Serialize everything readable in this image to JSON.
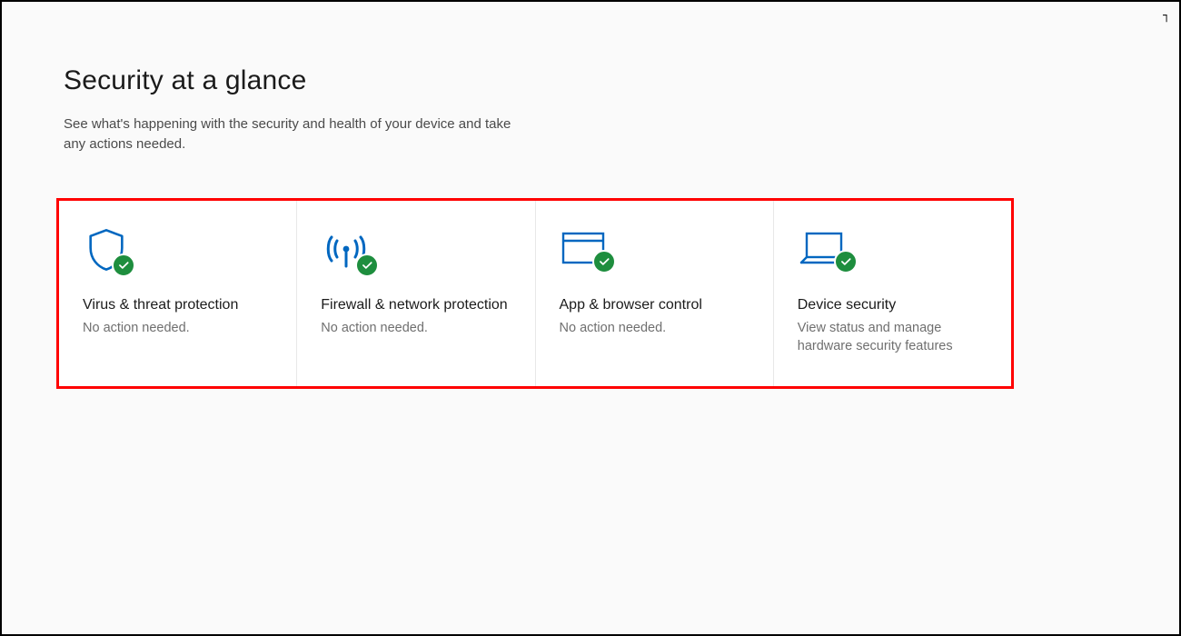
{
  "header": {
    "title": "Security at a glance",
    "subtitle": "See what's happening with the security and health of your device and take any actions needed."
  },
  "tiles": [
    {
      "icon": "shield-icon",
      "title": "Virus & threat protection",
      "desc": "No action needed."
    },
    {
      "icon": "antenna-icon",
      "title": "Firewall & network protection",
      "desc": "No action needed."
    },
    {
      "icon": "browser-icon",
      "title": "App & browser control",
      "desc": "No action needed."
    },
    {
      "icon": "laptop-icon",
      "title": "Device security",
      "desc": "View status and manage hardware security features"
    }
  ],
  "status_badge": "ok",
  "colors": {
    "accent": "#0067c0",
    "success": "#1e8e3e",
    "highlight": "#ff0000"
  }
}
